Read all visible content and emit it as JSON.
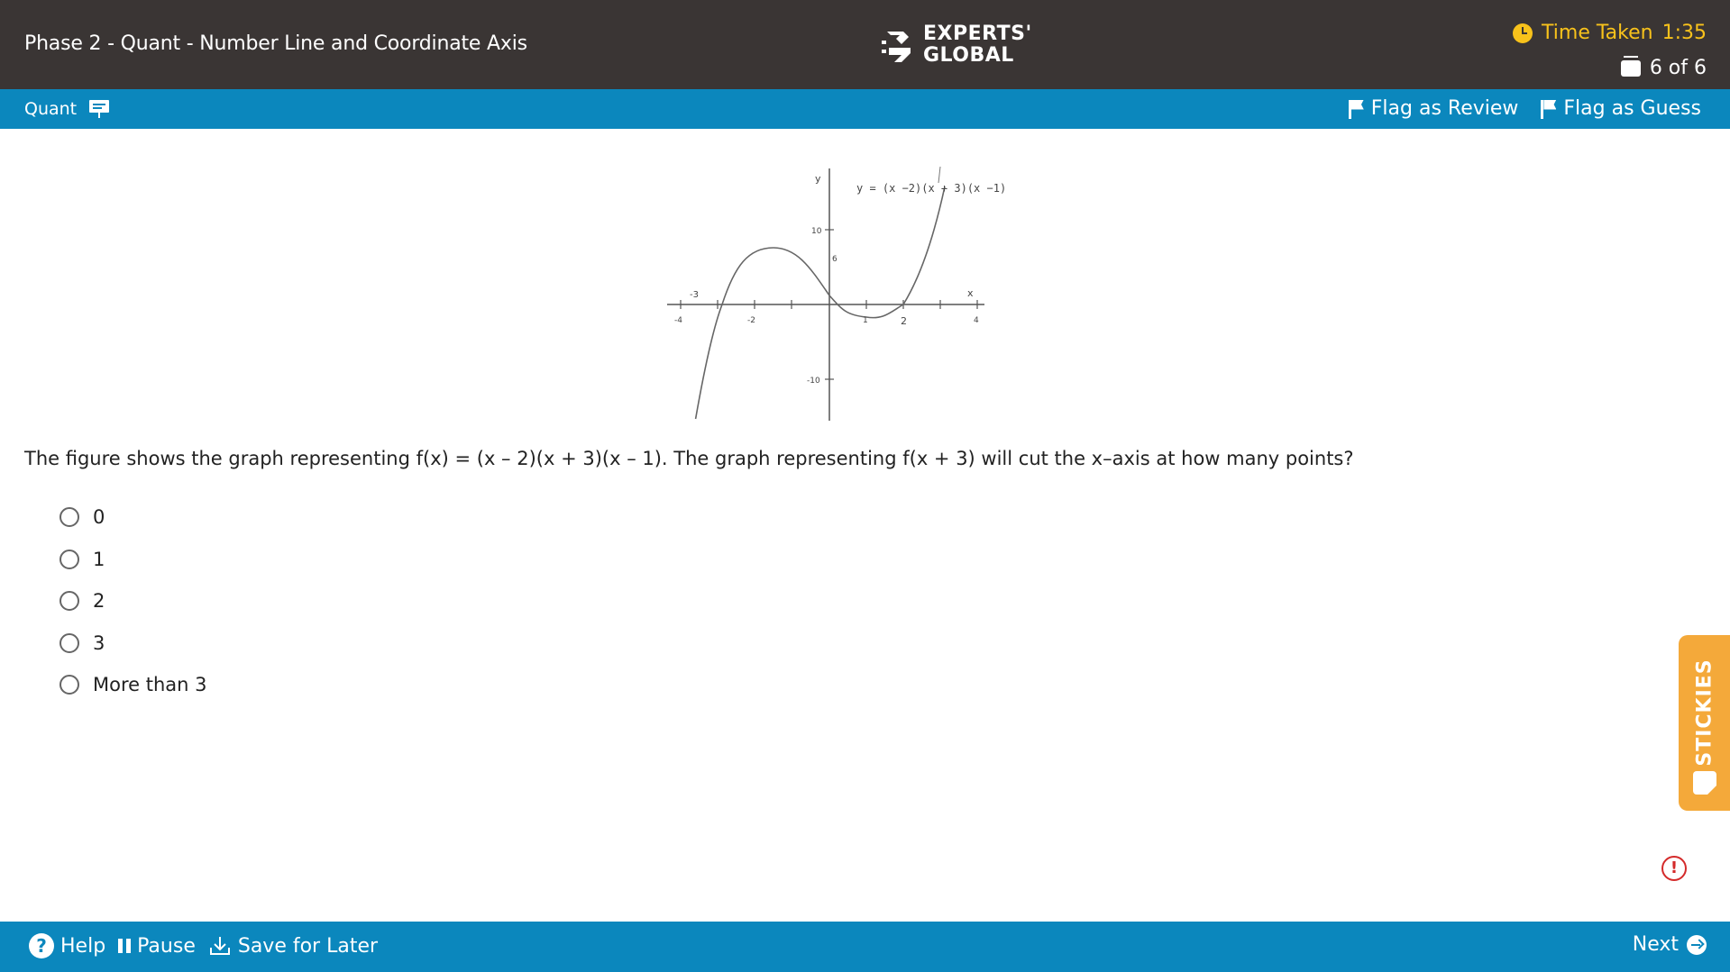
{
  "header": {
    "title": "Phase 2 - Quant - Number Line and Coordinate Axis",
    "logo_line1": "EXPERTS'",
    "logo_line2": "GLOBAL",
    "time_label": "Time Taken",
    "time_value": "1:35",
    "question_counter": "6 of 6",
    "colors": {
      "header_bg": "#3a3534",
      "timer": "#f8c21b"
    }
  },
  "section_bar": {
    "section_name": "Quant",
    "flag_review_label": "Flag as Review",
    "flag_guess_label": "Flag as Guess",
    "color": "#0b87bd"
  },
  "figure": {
    "y_label": "y",
    "x_label": "x",
    "equation": "y = (x −2)(x + 3)(x −1)",
    "label_neg3": "-3",
    "label_10": "10",
    "label_6": "6",
    "label_neg10": "-10",
    "tick_neg4": "-4",
    "tick_neg2": "-2",
    "tick_1": "1",
    "tick_2": "2",
    "tick_4": "4"
  },
  "question": {
    "text": "The figure shows the graph representing f(x) = (x – 2)(x + 3)(x – 1). The graph representing f(x + 3) will cut the x–axis at how many points?",
    "options": [
      "0",
      "1",
      "2",
      "3",
      "More than 3"
    ]
  },
  "stickies_label": "STICKIES",
  "alert_symbol": "!",
  "footer": {
    "help_label": "Help",
    "pause_label": "Pause",
    "save_label": "Save for Later",
    "next_label": "Next",
    "help_symbol": "?"
  }
}
